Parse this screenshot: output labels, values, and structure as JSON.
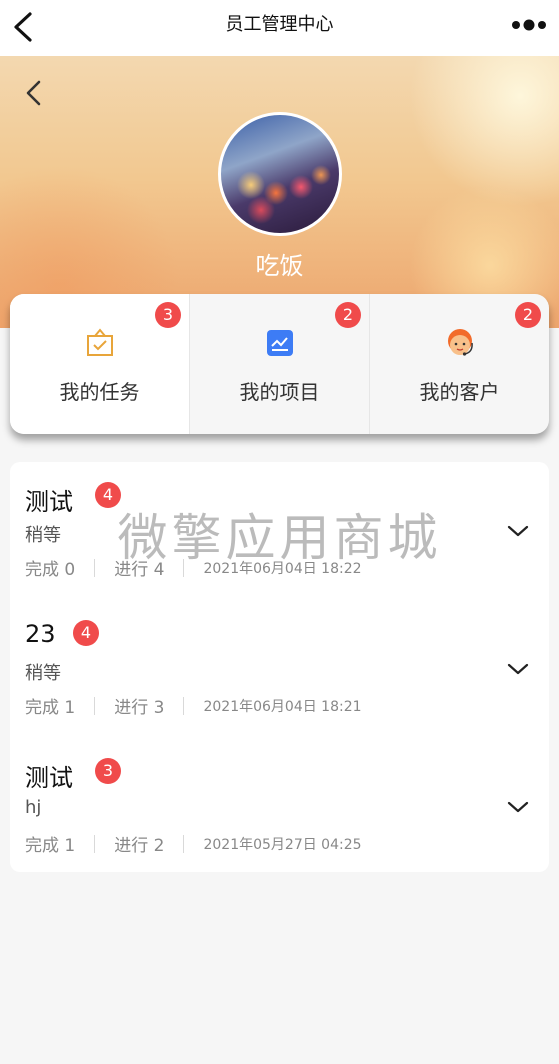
{
  "topbar": {
    "title": "员工管理中心"
  },
  "profile": {
    "name": "吃饭"
  },
  "tabs": [
    {
      "label": "我的任务",
      "badge": "3",
      "icon": "task-icon"
    },
    {
      "label": "我的项目",
      "badge": "2",
      "icon": "project-chart-icon"
    },
    {
      "label": "我的客户",
      "badge": "2",
      "icon": "customer-service-icon"
    }
  ],
  "items": [
    {
      "name": "测试",
      "badge": "4",
      "desc": "稍等",
      "done": "完成 0",
      "progress": "进行 4",
      "date": "2021年06月04日 18:22"
    },
    {
      "name": "23",
      "badge": "4",
      "desc": "稍等",
      "done": "完成 1",
      "progress": "进行 3",
      "date": "2021年06月04日 18:21"
    },
    {
      "name": "测试",
      "badge": "3",
      "desc": "hj",
      "done": "完成 1",
      "progress": "进行 2",
      "date": "2021年05月27日 04:25"
    }
  ],
  "watermark": "微擎应用商城",
  "colors": {
    "badge": "#f04b4b",
    "accent_blue": "#3d7cf5",
    "task_orange": "#e8a53a"
  }
}
